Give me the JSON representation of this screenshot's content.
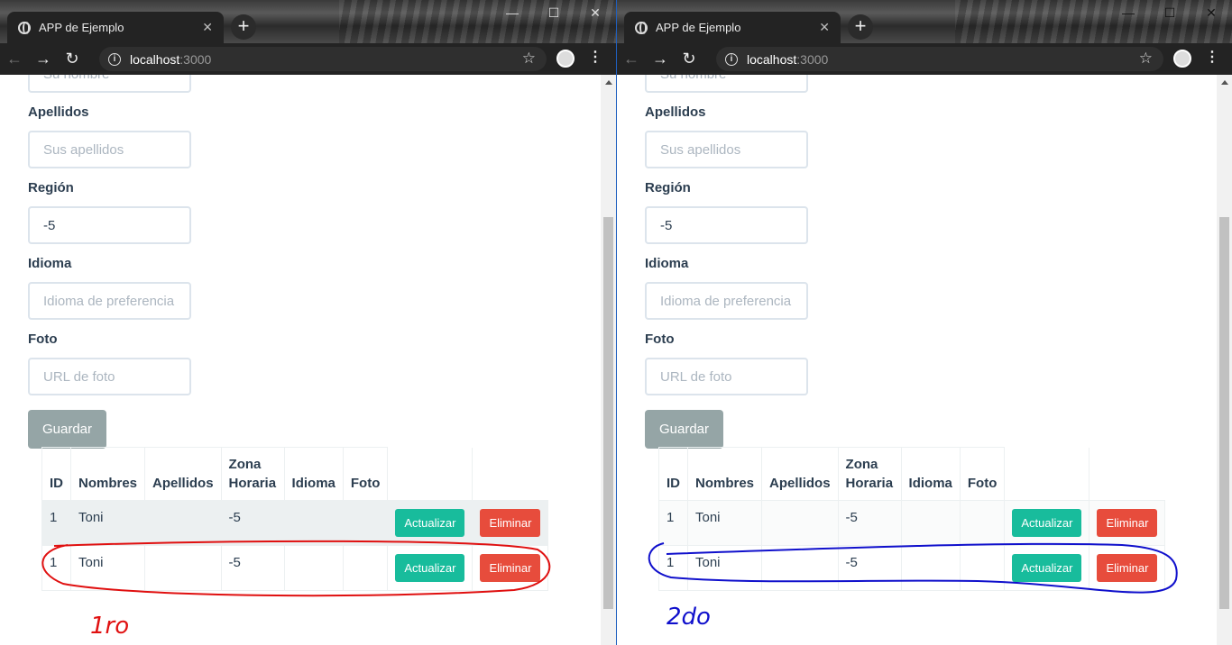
{
  "windows": [
    {
      "tab_title": "APP de Ejemplo",
      "url_host": "localhost",
      "url_port": ":3000",
      "form": {
        "top_placeholder": "Su nombre",
        "apellidos_label": "Apellidos",
        "apellidos_placeholder": "Sus apellidos",
        "region_label": "Región",
        "region_value": "-5",
        "idioma_label": "Idioma",
        "idioma_placeholder": "Idioma de preferencia",
        "foto_label": "Foto",
        "foto_placeholder": "URL de foto",
        "save_label": "Guardar"
      },
      "table": {
        "headers": [
          "ID",
          "Nombres",
          "Apellidos",
          "Zona Horaria",
          "Idioma",
          "Foto"
        ],
        "rows": [
          {
            "id": "1",
            "nombres": "Toni",
            "apellidos": "",
            "zona": "-5",
            "idioma": "",
            "foto": ""
          },
          {
            "id": "1",
            "nombres": "Toni",
            "apellidos": "",
            "zona": "-5",
            "idioma": "",
            "foto": ""
          }
        ],
        "update_label": "Actualizar",
        "delete_label": "Eliminar"
      },
      "annotation": {
        "text": "1ro",
        "color": "#e01010"
      }
    },
    {
      "tab_title": "APP de Ejemplo",
      "url_host": "localhost",
      "url_port": ":3000",
      "form": {
        "top_placeholder": "Su nombre",
        "apellidos_label": "Apellidos",
        "apellidos_placeholder": "Sus apellidos",
        "region_label": "Región",
        "region_value": "-5",
        "idioma_label": "Idioma",
        "idioma_placeholder": "Idioma de preferencia",
        "foto_label": "Foto",
        "foto_placeholder": "URL de foto",
        "save_label": "Guardar"
      },
      "table": {
        "headers": [
          "ID",
          "Nombres",
          "Apellidos",
          "Zona Horaria",
          "Idioma",
          "Foto"
        ],
        "rows": [
          {
            "id": "1",
            "nombres": "Toni",
            "apellidos": "",
            "zona": "-5",
            "idioma": "",
            "foto": ""
          },
          {
            "id": "1",
            "nombres": "Toni",
            "apellidos": "",
            "zona": "-5",
            "idioma": "",
            "foto": ""
          }
        ],
        "update_label": "Actualizar",
        "delete_label": "Eliminar"
      },
      "annotation": {
        "text": "2do",
        "color": "#1010cc"
      }
    }
  ]
}
